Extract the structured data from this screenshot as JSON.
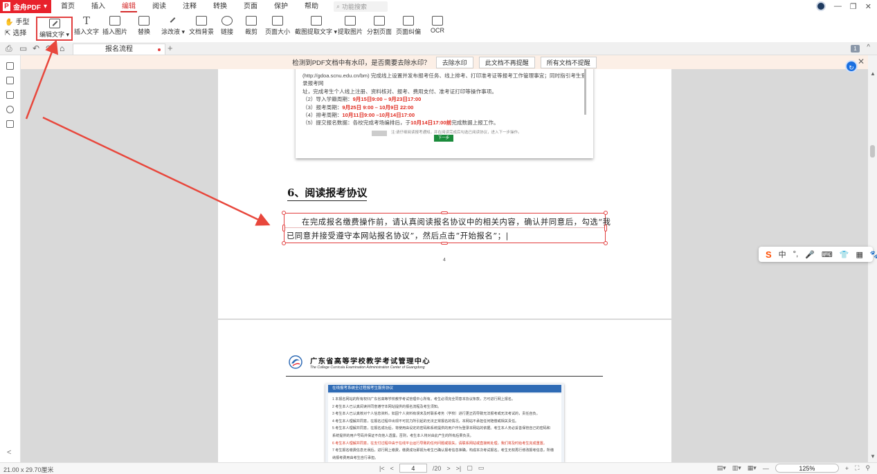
{
  "app": {
    "name": "金舟PDF",
    "logo_letter": "P"
  },
  "menu": {
    "items": [
      "首页",
      "插入",
      "编辑",
      "阅读",
      "注释",
      "转换",
      "页面",
      "保护",
      "帮助"
    ],
    "active": "编辑",
    "search_placeholder": "功能搜索"
  },
  "ribbon": {
    "hand": "手型",
    "select": "选择",
    "buttons": [
      {
        "label": "编辑文字 ▾",
        "icon": "edit-text-icon"
      },
      {
        "label": "插入文字",
        "icon": "insert-text-icon"
      },
      {
        "label": "插入图片",
        "icon": "insert-image-icon"
      },
      {
        "label": "替换",
        "icon": "replace-icon"
      },
      {
        "label": "涂改液 ▾",
        "icon": "eraser-icon"
      },
      {
        "label": "文档背景",
        "icon": "background-icon"
      },
      {
        "label": "链接",
        "icon": "link-icon"
      },
      {
        "label": "裁剪",
        "icon": "crop-icon"
      },
      {
        "label": "页面大小",
        "icon": "page-size-icon"
      },
      {
        "label": "截图提取文字 ▾",
        "icon": "screenshot-ocr-icon"
      },
      {
        "label": "提取图片",
        "icon": "extract-image-icon"
      },
      {
        "label": "分割页面",
        "icon": "split-page-icon"
      },
      {
        "label": "页面纠偏",
        "icon": "deskew-icon"
      },
      {
        "label": "OCR",
        "icon": "ocr-icon"
      }
    ]
  },
  "tabs": {
    "doc_title": "报名流程",
    "page_count_badge": "1"
  },
  "watermark_bar": {
    "message": "检测到PDF文档中有水印，是否需要去除水印？",
    "buttons": [
      "去除水印",
      "此文档不再提醒",
      "所有文档不提醒"
    ]
  },
  "page1": {
    "screenshot_lines": [
      "(http://gdoa.scnu.edu.cn/bm) 完成线上设置并发布报考任务、线上排考、打印准考证等报考工作管理事宜；同时指引考生登录报考网",
      "址，完成考生个人线上注册、资料核对、报考、费用支付、准考证打印等操作事项。"
    ],
    "schedule": [
      {
        "prefix": "（2）导入学籍周期：",
        "value": "9月15日9:00 – 9月23日17:00",
        "suffix": ""
      },
      {
        "prefix": "（3）报考周期：",
        "value": "9月25日 9:00 – 10月9日 22:00",
        "suffix": ""
      },
      {
        "prefix": "（4）排考周期：",
        "value": "10月11日9:00 –10月14日17:00",
        "suffix": ""
      },
      {
        "prefix": "（5）提交报名数据：各校完成考场编排后，于",
        "value": "10月14日17:00前",
        "suffix": "完成数据上报工作。"
      }
    ],
    "small_note": "注:请仔细阅读报考通知，并在阅读完成后勾选已阅读协议，进入下一步操作。",
    "next_button": "下一步",
    "heading": "6、阅读报考协议",
    "paragraph": "在完成报名缴费操作前，请认真阅读报名协议中的相关内容，确认并同意后，勾选“我已同意并接受遵守本网站报名协议”，然后点击“开始报名”；|",
    "page_number": "4"
  },
  "page2": {
    "org_title": "广东省高等学校教学考试管理中心",
    "org_subtitle": "The College Curricula Examination Administration Center of Guangdong",
    "agreement_header": "在线报考系统全过程报考生服务协议",
    "agreement_lines": [
      {
        "text": "1 本报名网站的所有权归广东省高等学校教学考试管理中心所有。考生必须完全同意本协议条款，方可进行网上报名。",
        "warn": false
      },
      {
        "text": "2 考生本人已认真阅读并同意遵守本网站提供的报名流程及考生须知。",
        "warn": false
      },
      {
        "text": "3 考生本人已认真核对个人信息资料，如因个人资料有误未及时联系考务（学校）进行更正而导致无法报考或无法考试的，责任自负。",
        "warn": false
      },
      {
        "text": "4 考生本人理解并同意，在报名过程中出现不可抗力所引起的无法正常报名的情况，本网站不承担任何赔偿或相关责任。",
        "warn": false
      },
      {
        "text": "5 考生本人理解并同意，在报名成功后，将使用由设定的密码和系统提供的用户作为登录本网站的依据。考生本人务必妥善保管自己的密码和",
        "warn": false
      },
      {
        "text": "系统提供的用户号码并保证不向他人透露。否则，考生本人将对由此产生的所有后果负责。",
        "warn": false
      },
      {
        "text": "6 考生本人理解并同意，在支付过程中由于在线平台运行导致的任何问题或损失，请联系网站或直接到处理，我们将及时给考生完成重置。",
        "warn": true
      },
      {
        "text": "7 考生报名缴费信息无误后，进行网上缴费，缴费成功即视为考生已确认报考信息准确，构成本次考试报名。考生无权再行修改报考信息，所缴",
        "warn": false
      },
      {
        "text": "纳报考费用由考生自行承担。",
        "warn": false
      }
    ]
  },
  "ime": {
    "brand": "S",
    "mode": "中",
    "items": [
      "°,",
      "🎤",
      "⌨",
      "👕",
      "▦",
      "🐾"
    ]
  },
  "status": {
    "page_dimensions": "21.00 x 29.70厘米",
    "current_page": "4",
    "total_pages": "/20",
    "zoom": "125%"
  },
  "colors": {
    "brand_red": "#e8212b",
    "highlight_red": "#e23d3d",
    "arrow_red": "#e8473c",
    "accent_blue": "#1a6fe0"
  }
}
